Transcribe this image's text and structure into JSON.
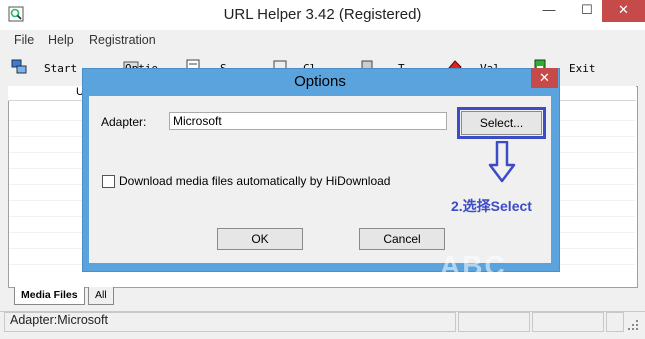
{
  "window": {
    "title": "URL Helper 3.42 (Registered)",
    "controls": {
      "minimize": "—",
      "maximize": "☐",
      "close": "✕"
    }
  },
  "menu": [
    "File",
    "Help",
    "Registration"
  ],
  "toolbar": {
    "items": [
      {
        "label": "Start",
        "icon": "start-icon"
      },
      {
        "label": "Optio",
        "icon": "options-icon"
      },
      {
        "label": "S",
        "icon": "save-icon"
      },
      {
        "label": "Cl",
        "icon": "clear-icon"
      },
      {
        "label": "T",
        "icon": "tool-icon"
      },
      {
        "label": "Val",
        "icon": "value-icon"
      },
      {
        "label": "Exit",
        "icon": "exit-icon"
      }
    ]
  },
  "list": {
    "header_fragment": "U"
  },
  "tabs": [
    {
      "label": "Media Files",
      "active": true
    },
    {
      "label": "All",
      "active": false
    }
  ],
  "status": {
    "text": "Adapter:Microsoft"
  },
  "dialog": {
    "title": "Options",
    "close": "✕",
    "adapter_label": "Adapter:",
    "adapter_value": "Microsoft",
    "select_button": "Select...",
    "checkbox_label": "Download media files automatically by HiDownload",
    "checkbox_checked": false,
    "ok_button": "OK",
    "cancel_button": "Cancel"
  },
  "annotation": {
    "text": "2.选择Select",
    "color": "#3c4bc6"
  },
  "watermark": {
    "text": "ABC"
  }
}
